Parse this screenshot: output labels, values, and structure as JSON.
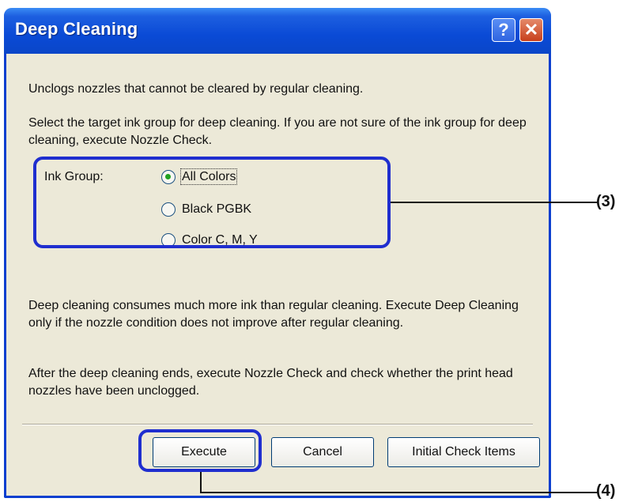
{
  "window": {
    "title": "Deep Cleaning",
    "help_glyph": "?",
    "close_glyph": "✕"
  },
  "text": {
    "intro": "Unclogs nozzles that cannot be cleared by regular cleaning.",
    "select_target": "Select the target ink group for deep cleaning. If you are not sure of the ink group for deep cleaning, execute Nozzle Check.",
    "warning": "Deep cleaning consumes much more ink than regular cleaning. Execute Deep Cleaning only if the nozzle condition does not improve after regular cleaning.",
    "after": "After the deep cleaning ends, execute Nozzle Check and check whether the print head nozzles have been unclogged."
  },
  "ink_group": {
    "label": "Ink Group:",
    "options": [
      {
        "label": "All Colors",
        "selected": true
      },
      {
        "label": "Black   PGBK",
        "selected": false
      },
      {
        "label": "Color   C, M, Y",
        "selected": false
      }
    ]
  },
  "buttons": {
    "execute": "Execute",
    "cancel": "Cancel",
    "initial_check": "Initial Check Items"
  },
  "callouts": {
    "ink_group": "(3)",
    "execute": "(4)"
  },
  "colors": {
    "titlebar": "#0a4ad6",
    "dialog_bg": "#ece9d8",
    "annotation": "#1f2ecf",
    "radio_dot": "#21a121"
  }
}
